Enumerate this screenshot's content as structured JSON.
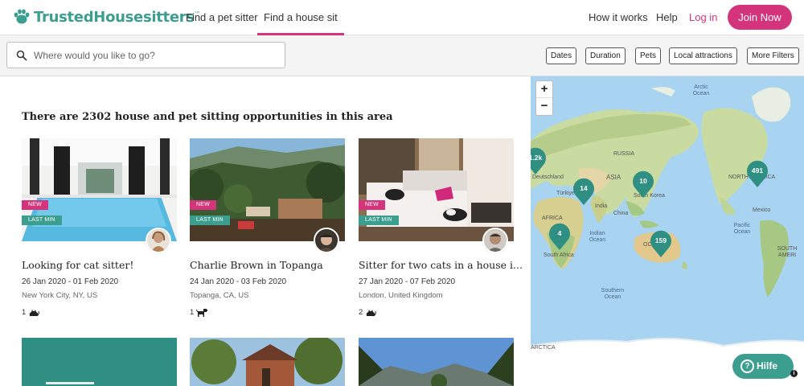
{
  "brand": {
    "name": "TrustedHousesitters",
    "trademark": "™",
    "accent": "#3b9e8f",
    "pink": "#d3347c"
  },
  "nav": {
    "find_sitter": "Find a pet sitter",
    "find_house": "Find a house sit",
    "how_it_works": "How it works",
    "help": "Help",
    "login": "Log in",
    "join": "Join Now"
  },
  "search": {
    "placeholder": "Where would you like to go?",
    "icon": "search-icon"
  },
  "filters": {
    "dates": "Dates",
    "duration": "Duration",
    "pets": "Pets",
    "local": "Local attractions",
    "more": "More Filters"
  },
  "results": {
    "heading": "There are 2302 house and pet sitting opportunities in this area"
  },
  "cards": [
    {
      "badge_new": "NEW",
      "badge_last": "LAST MIN",
      "title": "Looking for cat sitter!",
      "dates": "26 Jan 2020 - 01 Feb 2020",
      "location": "New York City, NY, US",
      "pet_count": "1",
      "pet_icon": "cat-icon"
    },
    {
      "badge_new": "NEW",
      "badge_last": "LAST MIN",
      "title": "Charlie Brown in Topanga",
      "dates": "24 Jan 2020 - 03 Feb 2020",
      "location": "Topanga, CA, US",
      "pet_count": "1",
      "pet_icon": "dog-icon"
    },
    {
      "badge_new": "NEW",
      "badge_last": "LAST MIN",
      "title": "Sitter for two cats in a house i...",
      "dates": "27 Jan 2020 - 07 Feb 2020",
      "location": "London, United Kingdom",
      "pet_count": "2",
      "pet_icon": "cat-icon"
    }
  ],
  "row2": {
    "partial_text": ""
  },
  "map": {
    "zoom_in": "+",
    "zoom_out": "−",
    "markers": {
      "europe": "1.2k",
      "middle_east": "14",
      "east_asia": "10",
      "north_america": "491",
      "africa": "4",
      "australia": "159"
    },
    "labels": {
      "arctic_ocean": "Arctic Ocean",
      "russia": "RUSSIA",
      "deutschland": "Deutschland",
      "asia": "ASIA",
      "turkiye": "Türkiye",
      "south_korea": "South Korea",
      "china": "China",
      "africa": "AFRICA",
      "india": "India",
      "indian_ocean": "Indian Ocean",
      "south_africa": "South Africa",
      "oceania": "OC",
      "southern_ocean": "Southern Ocean",
      "antarctica": "ARCTICA",
      "north_america": "NORTH AMERICA",
      "mexico": "Mexico",
      "pacific_ocean": "Pacific Ocean",
      "south_america": "SOUTH AMERI"
    },
    "help": "Hilfe"
  }
}
